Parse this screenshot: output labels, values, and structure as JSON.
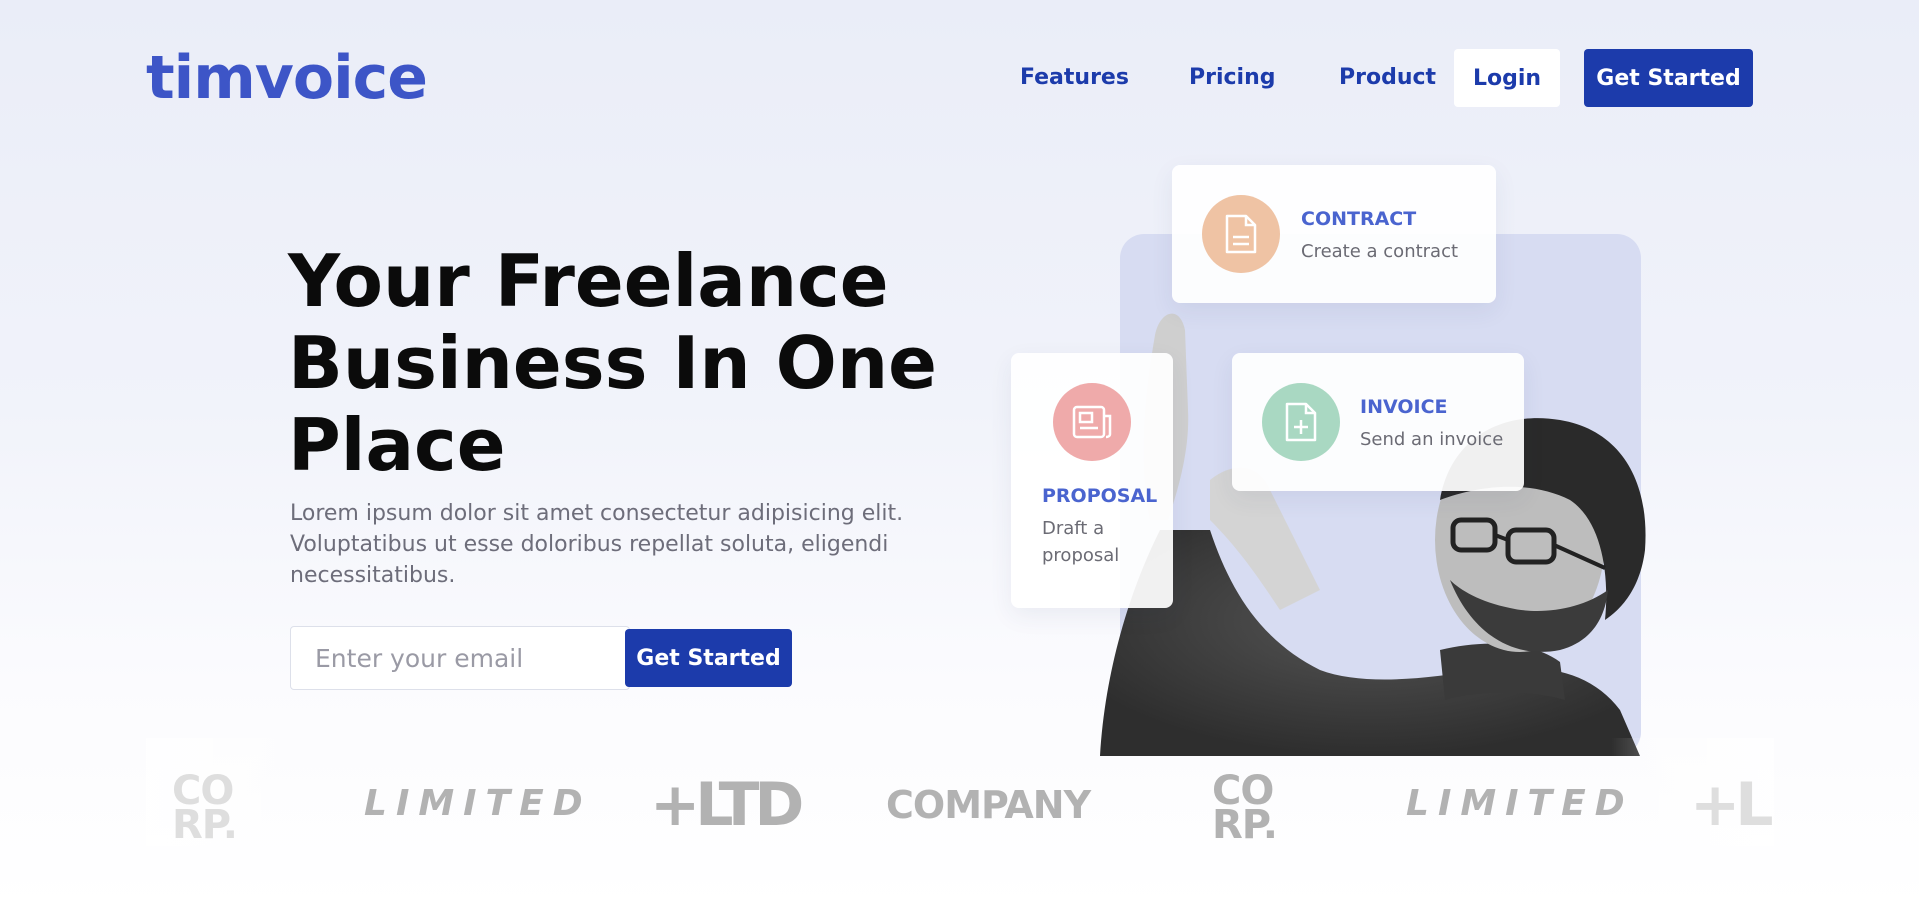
{
  "header": {
    "logo": "timvoice",
    "nav": [
      {
        "label": "Features"
      },
      {
        "label": "Pricing"
      },
      {
        "label": "Product"
      }
    ],
    "login_label": "Login",
    "get_started_label": "Get Started"
  },
  "hero": {
    "title_lines": [
      "Your Freelance",
      "Business In One",
      "Place"
    ],
    "description_lines": [
      "Lorem ipsum dolor sit amet consectetur adipisicing elit.",
      "Voluptatibus ut esse doloribus repellat soluta, eligendi",
      "necessitatibus."
    ],
    "email_placeholder": "Enter your email",
    "email_value": "",
    "cta_label": "Get Started"
  },
  "cards": {
    "contract": {
      "title": "CONTRACT",
      "subtitle": "Create a contract",
      "icon": "document-icon",
      "color": "#efc3a4"
    },
    "invoice": {
      "title": "INVOICE",
      "subtitle": "Send an invoice",
      "icon": "file-plus-icon",
      "color": "#a9d8c2"
    },
    "proposal": {
      "title": "PROPOSAL",
      "subtitle_lines": [
        "Draft a",
        "proposal"
      ],
      "icon": "newspaper-icon",
      "color": "#efaaaa"
    }
  },
  "brands": [
    {
      "kind": "corp",
      "lines": [
        "CO",
        "RP."
      ]
    },
    {
      "kind": "limited",
      "text": "LIMITED"
    },
    {
      "kind": "ltd",
      "text": "+LTD"
    },
    {
      "kind": "company",
      "text": "COMPANY"
    },
    {
      "kind": "corp",
      "lines": [
        "CO",
        "RP."
      ]
    },
    {
      "kind": "limited",
      "text": "LIMITED"
    },
    {
      "kind": "ltd",
      "text": "+L"
    }
  ],
  "colors": {
    "brand_primary": "#1c3bab",
    "logo_blue": "#3d55c7",
    "panel_bg": "#d7dcf2",
    "card_title": "#4a64cf"
  }
}
